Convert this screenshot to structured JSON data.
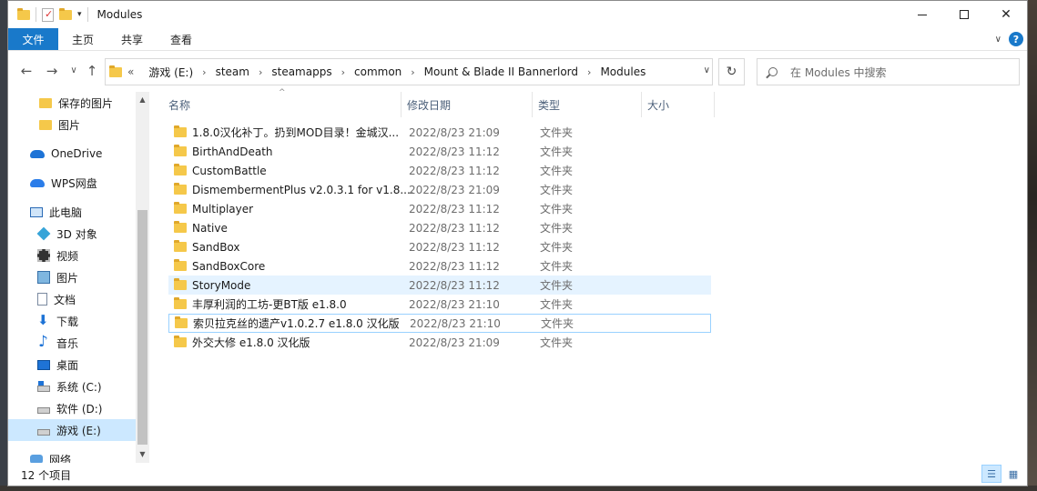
{
  "window": {
    "title": "Modules"
  },
  "ribbon": {
    "tabs": [
      "文件",
      "主页",
      "共享",
      "查看"
    ]
  },
  "address": {
    "overflow": "«",
    "crumbs": [
      "游戏 (E:)",
      "steam",
      "steamapps",
      "common",
      "Mount & Blade II Bannerlord",
      "Modules"
    ]
  },
  "search": {
    "placeholder": "在 Modules 中搜索"
  },
  "nav": {
    "items": [
      {
        "label": "保存的图片",
        "icon": "folder-icon"
      },
      {
        "label": "图片",
        "icon": "folder-icon"
      },
      {
        "label": "OneDrive",
        "icon": "onedrive-cloud-icon"
      },
      {
        "label": "WPS网盘",
        "icon": "wps-cloud-icon"
      },
      {
        "label": "此电脑",
        "icon": "computer-icon"
      },
      {
        "label": "3D 对象",
        "icon": "3d-objects-icon"
      },
      {
        "label": "视频",
        "icon": "video-icon"
      },
      {
        "label": "图片",
        "icon": "pictures-icon"
      },
      {
        "label": "文档",
        "icon": "documents-icon"
      },
      {
        "label": "下载",
        "icon": "download-icon"
      },
      {
        "label": "音乐",
        "icon": "music-icon"
      },
      {
        "label": "桌面",
        "icon": "desktop-icon"
      },
      {
        "label": "系统 (C:)",
        "icon": "system-drive-icon"
      },
      {
        "label": "软件 (D:)",
        "icon": "drive-icon"
      },
      {
        "label": "游戏 (E:)",
        "icon": "drive-icon"
      },
      {
        "label": "网络",
        "icon": "network-icon"
      }
    ]
  },
  "columns": {
    "name": "名称",
    "date": "修改日期",
    "type": "类型",
    "size": "大小"
  },
  "files": [
    {
      "name": "1.8.0汉化补丁。扔到MOD目录！金城汉...",
      "date": "2022/8/23 21:09",
      "type": "文件夹"
    },
    {
      "name": "BirthAndDeath",
      "date": "2022/8/23 11:12",
      "type": "文件夹"
    },
    {
      "name": "CustomBattle",
      "date": "2022/8/23 11:12",
      "type": "文件夹"
    },
    {
      "name": "DismembermentPlus v2.0.3.1 for v1.8....",
      "date": "2022/8/23 21:09",
      "type": "文件夹"
    },
    {
      "name": "Multiplayer",
      "date": "2022/8/23 11:12",
      "type": "文件夹"
    },
    {
      "name": "Native",
      "date": "2022/8/23 11:12",
      "type": "文件夹"
    },
    {
      "name": "SandBox",
      "date": "2022/8/23 11:12",
      "type": "文件夹"
    },
    {
      "name": "SandBoxCore",
      "date": "2022/8/23 11:12",
      "type": "文件夹"
    },
    {
      "name": "StoryMode",
      "date": "2022/8/23 11:12",
      "type": "文件夹"
    },
    {
      "name": "丰厚利润的工坊-更BT版 e1.8.0",
      "date": "2022/8/23 21:10",
      "type": "文件夹"
    },
    {
      "name": "索贝拉克丝的遗产v1.0.2.7 e1.8.0 汉化版",
      "date": "2022/8/23 21:10",
      "type": "文件夹"
    },
    {
      "name": "外交大修 e1.8.0 汉化版",
      "date": "2022/8/23 21:09",
      "type": "文件夹"
    }
  ],
  "status": {
    "count": "12 个项目"
  },
  "colors": {
    "accent": "#1979ca",
    "hover": "#e5f3ff",
    "selected": "#cce8ff",
    "folder": "#f5c84a"
  }
}
